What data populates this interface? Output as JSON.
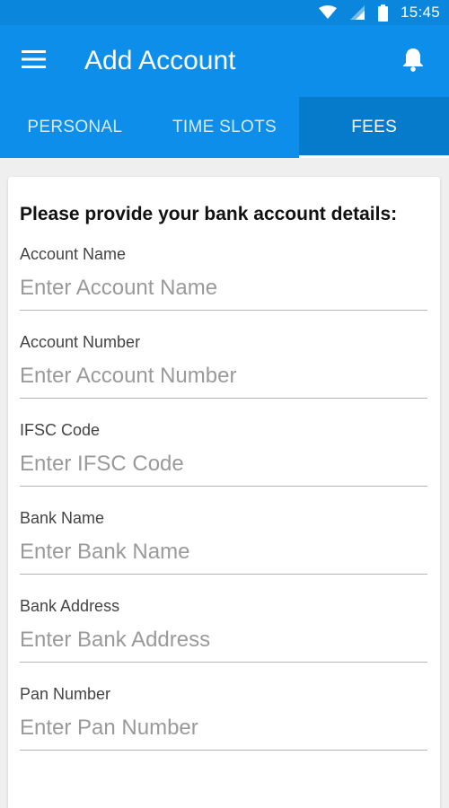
{
  "status_bar": {
    "time": "15:45",
    "icons": [
      "wifi-icon",
      "signal-icon",
      "battery-icon"
    ]
  },
  "app_bar": {
    "title": "Add Account",
    "menu_icon": "menu-icon",
    "bell_icon": "bell-icon"
  },
  "tabs": [
    {
      "label": "PERSONAL",
      "active": false
    },
    {
      "label": "TIME SLOTS",
      "active": false
    },
    {
      "label": "FEES",
      "active": true
    }
  ],
  "form": {
    "heading": "Please provide your bank account details:",
    "fields": [
      {
        "label": "Account Name",
        "placeholder": "Enter Account Name",
        "value": ""
      },
      {
        "label": "Account Number",
        "placeholder": "Enter Account Number",
        "value": ""
      },
      {
        "label": "IFSC Code",
        "placeholder": "Enter IFSC Code",
        "value": ""
      },
      {
        "label": "Bank Name",
        "placeholder": "Enter Bank Name",
        "value": ""
      },
      {
        "label": "Bank Address",
        "placeholder": "Enter Bank Address",
        "value": ""
      },
      {
        "label": "Pan Number",
        "placeholder": "Enter Pan Number",
        "value": ""
      }
    ]
  },
  "colors": {
    "primary": "#0d8eeb",
    "status_bar": "#0b86dd",
    "active_tab": "#067acb",
    "background": "#efefef"
  }
}
